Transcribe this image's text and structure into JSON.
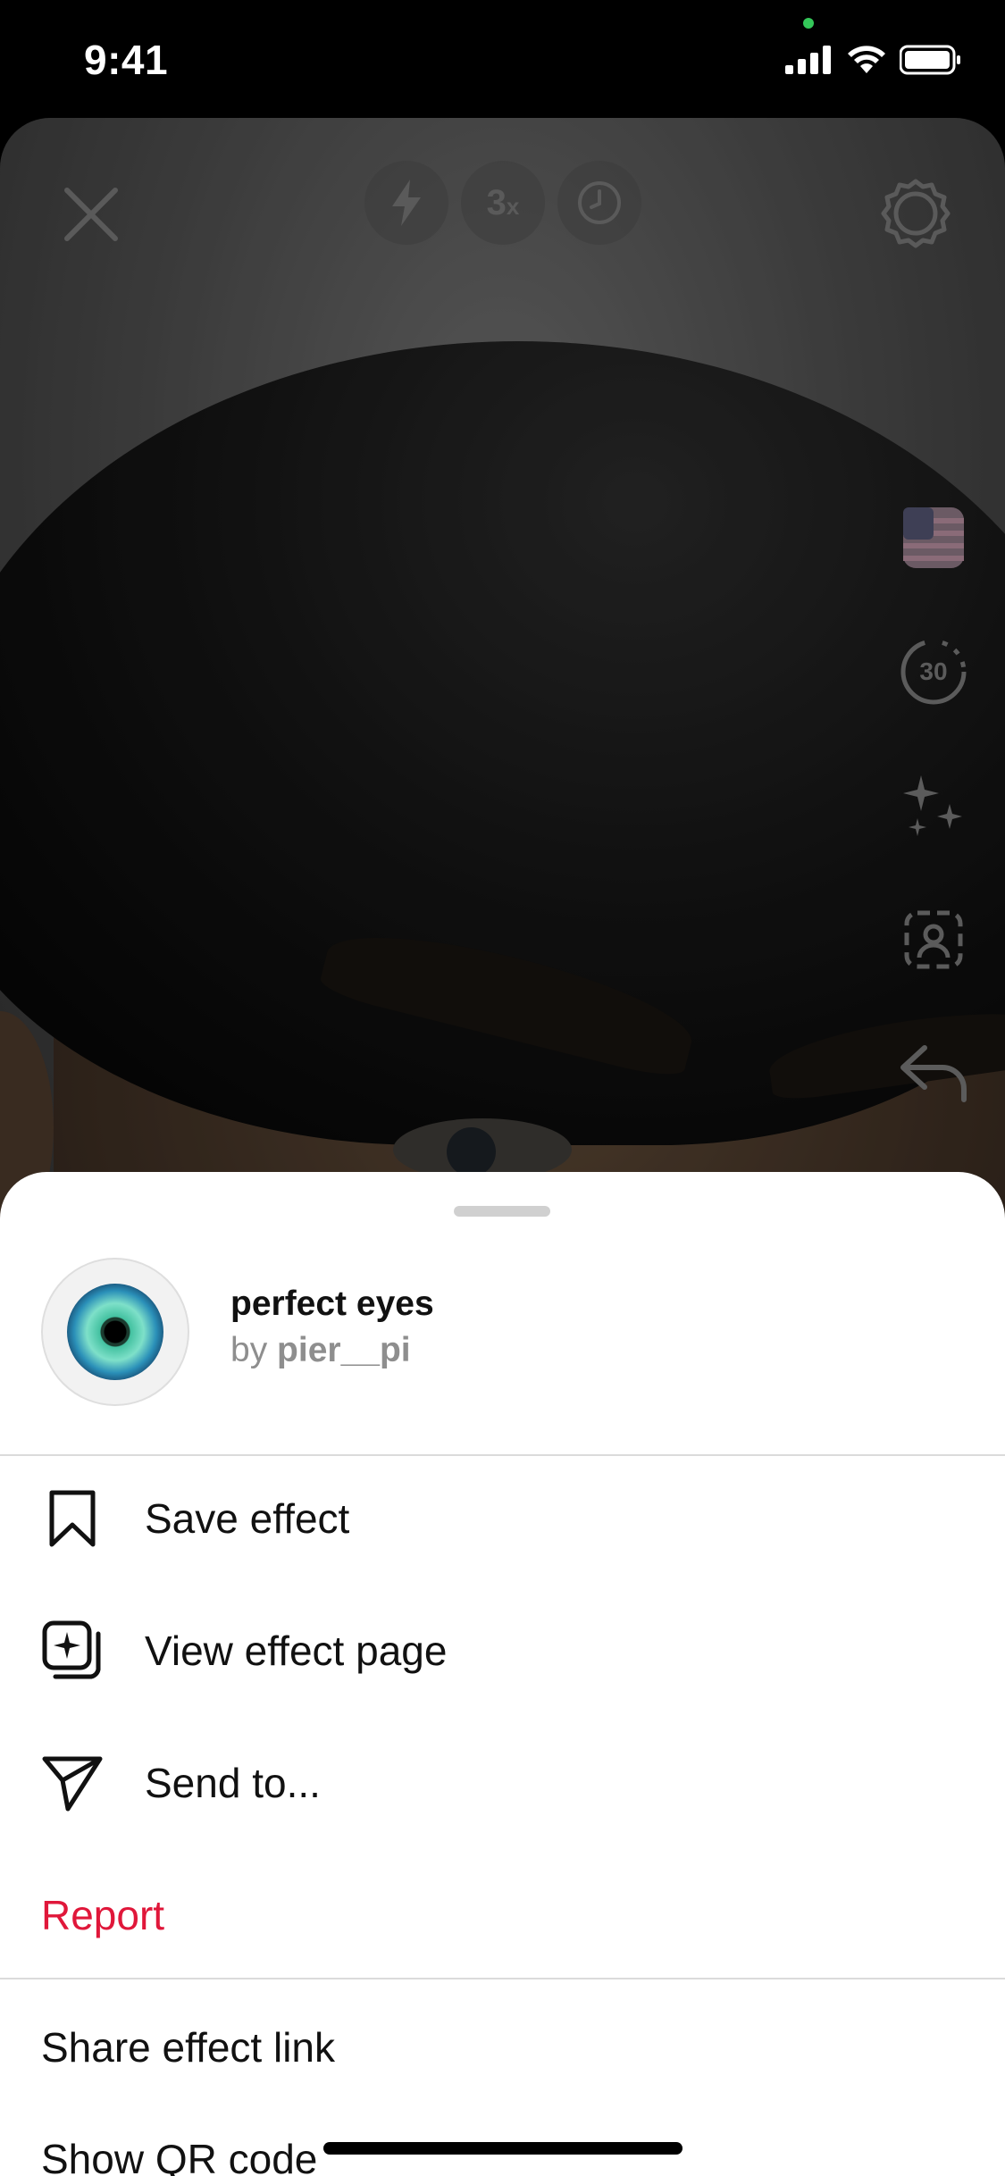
{
  "status_bar": {
    "time": "9:41"
  },
  "camera": {
    "zoom_label": "3",
    "zoom_suffix": "x",
    "timer_value": "30"
  },
  "sheet": {
    "effect": {
      "title": "perfect eyes",
      "author_prefix": "by",
      "author_name": "pier__pi"
    },
    "menu": {
      "save_label": "Save effect",
      "view_label": "View effect page",
      "send_label": "Send to...",
      "report_label": "Report",
      "share_label": "Share effect link",
      "qr_label": "Show QR code"
    }
  },
  "colors": {
    "report_red": "#e0173a",
    "divider": "#dbdbdb",
    "status_dot_green": "#34c759"
  }
}
